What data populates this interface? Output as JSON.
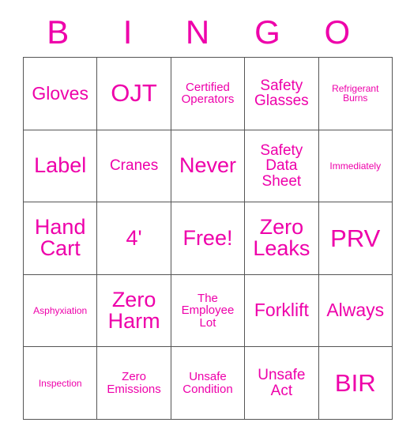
{
  "card": {
    "title": "BINGO",
    "accent_color": "#ee00aa",
    "border_color": "#555555",
    "background_color": "#ffffff",
    "header_letters": [
      "B",
      "I",
      "N",
      "G",
      "O"
    ],
    "columns": 5,
    "rows": 5,
    "free_space": "Free!",
    "cells": [
      [
        {
          "text": "Gloves",
          "size": "fs-l"
        },
        {
          "text": "OJT",
          "size": "fs-xxl"
        },
        {
          "text": "Certified Operators",
          "size": "fs-s"
        },
        {
          "text": "Safety Glasses",
          "size": "fs-m"
        },
        {
          "text": "Refrigerant Burns",
          "size": "fs-xs"
        }
      ],
      [
        {
          "text": "Label",
          "size": "fs-xl"
        },
        {
          "text": "Cranes",
          "size": "fs-m"
        },
        {
          "text": "Never",
          "size": "fs-xl"
        },
        {
          "text": "Safety Data Sheet",
          "size": "fs-m"
        },
        {
          "text": "Immediately",
          "size": "fs-xs"
        }
      ],
      [
        {
          "text": "Hand Cart",
          "size": "fs-xl"
        },
        {
          "text": "4'",
          "size": "fs-xl"
        },
        {
          "text": "Free!",
          "size": "fs-xl"
        },
        {
          "text": "Zero Leaks",
          "size": "fs-xl"
        },
        {
          "text": "PRV",
          "size": "fs-xxl"
        }
      ],
      [
        {
          "text": "Asphyxiation",
          "size": "fs-xs"
        },
        {
          "text": "Zero Harm",
          "size": "fs-xl"
        },
        {
          "text": "The Employee Lot",
          "size": "fs-s"
        },
        {
          "text": "Forklift",
          "size": "fs-l"
        },
        {
          "text": "Always",
          "size": "fs-l"
        }
      ],
      [
        {
          "text": "Inspection",
          "size": "fs-xs"
        },
        {
          "text": "Zero Emissions",
          "size": "fs-s"
        },
        {
          "text": "Unsafe Condition",
          "size": "fs-s"
        },
        {
          "text": "Unsafe Act",
          "size": "fs-m"
        },
        {
          "text": "BIR",
          "size": "fs-xxl"
        }
      ]
    ]
  }
}
